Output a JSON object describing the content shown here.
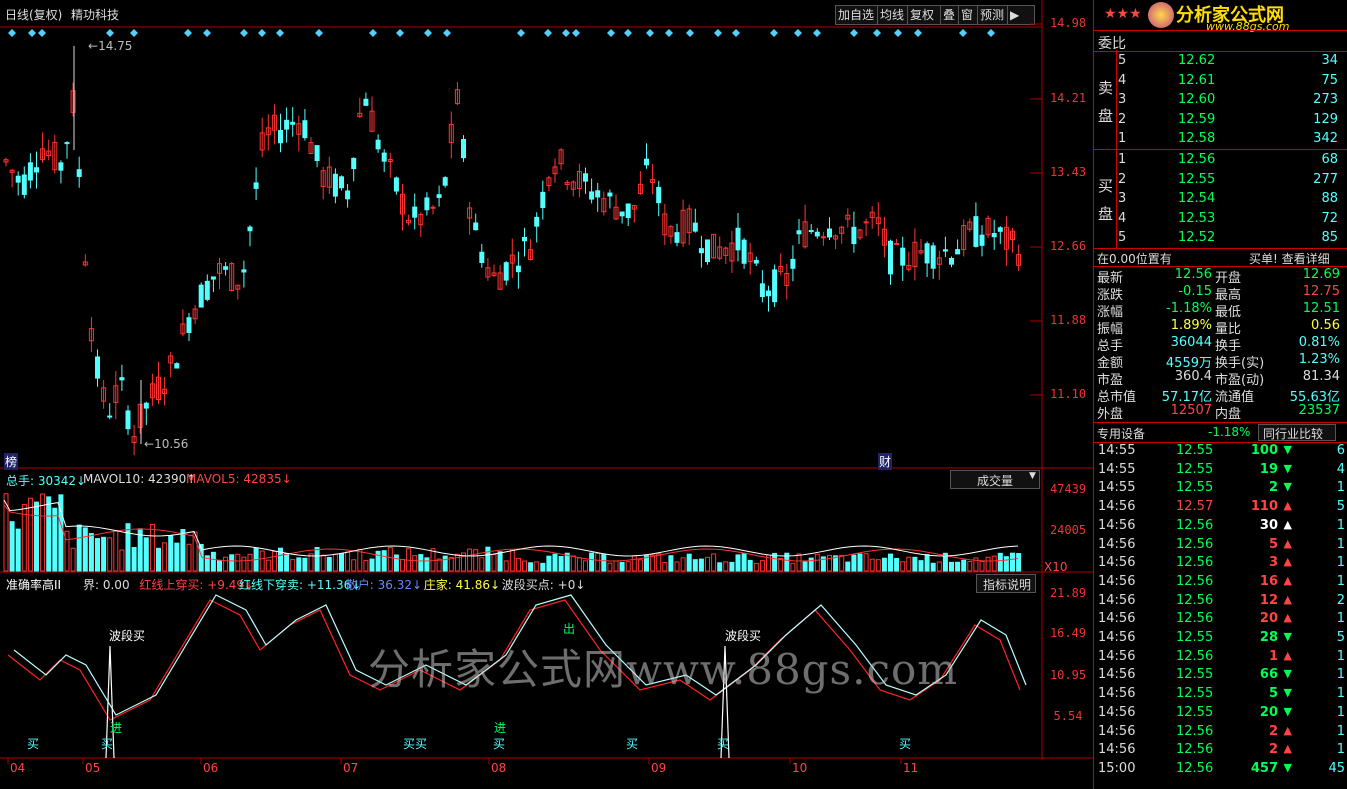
{
  "header": {
    "period_label": "日线(复权)",
    "stock_name": "精功科技",
    "buttons": [
      "加自选",
      "均线",
      "复权",
      "叠",
      "窗",
      "预测",
      "▶"
    ],
    "stars": "★★★",
    "logo_text": "分析家公式网",
    "logo_url": "www.88gs.com"
  },
  "price_chart": {
    "y_ticks": [
      "14.98",
      "14.21",
      "13.43",
      "12.66",
      "11.88",
      "11.10"
    ],
    "high_marker": "14.75",
    "low_marker": "10.56",
    "bang_label": "榜",
    "cai_label": "财"
  },
  "volume_panel": {
    "total_label": "总手: 30342↓",
    "mavol10_label": "MAVOL10: 42390↑",
    "mavol5_label": "MAVOL5: 42835↓",
    "dropdown_label": "成交量",
    "y_ticks": [
      "47439",
      "24005"
    ],
    "unit": "X10"
  },
  "indicator_panel": {
    "name": "准确率高II",
    "params": [
      {
        "text": "界: 0.00",
        "color": "#dddddd"
      },
      {
        "text": "红线上穿买: +9.49↓",
        "color": "#ff4444"
      },
      {
        "text": "红线下穿卖: +11.36↓",
        "color": "#54ffff"
      },
      {
        "text": "散户: 36.32↓",
        "color": "#6688ff"
      },
      {
        "text": "庄家: 41.86↓",
        "color": "#ffff44"
      },
      {
        "text": "波段买点: +0↓",
        "color": "#dddddd"
      }
    ],
    "button": "指标说明",
    "y_ticks": [
      "21.89",
      "16.49",
      "10.95",
      "5.54"
    ],
    "marks": {
      "buy": "买",
      "buy2": "买买",
      "enter": "进",
      "exit": "出",
      "band_buy": "波段买"
    }
  },
  "x_axis": {
    "months": [
      "04",
      "05",
      "06",
      "07",
      "08",
      "09",
      "10",
      "11"
    ]
  },
  "watermark": "分析家公式网www.88gs.com",
  "order_book": {
    "committee_label": "委比",
    "sell_label": "卖盘",
    "buy_label": "买盘",
    "sell": [
      {
        "level": "5",
        "price": "12.62",
        "vol": "34"
      },
      {
        "level": "4",
        "price": "12.61",
        "vol": "75"
      },
      {
        "level": "3",
        "price": "12.60",
        "vol": "273"
      },
      {
        "level": "2",
        "price": "12.59",
        "vol": "129"
      },
      {
        "level": "1",
        "price": "12.58",
        "vol": "342"
      }
    ],
    "buy": [
      {
        "level": "1",
        "price": "12.56",
        "vol": "68"
      },
      {
        "level": "2",
        "price": "12.55",
        "vol": "277"
      },
      {
        "level": "3",
        "price": "12.54",
        "vol": "88"
      },
      {
        "level": "4",
        "price": "12.53",
        "vol": "72"
      },
      {
        "level": "5",
        "price": "12.52",
        "vol": "85"
      }
    ]
  },
  "position_bar": {
    "left": "在0.00位置有",
    "right": "买单! 查看详细"
  },
  "stats": [
    {
      "l1": "最新",
      "v1": "12.56",
      "c1": "#00ff55",
      "l2": "开盘",
      "v2": "12.69",
      "c2": "#00ff55"
    },
    {
      "l1": "涨跌",
      "v1": "-0.15",
      "c1": "#00ff55",
      "l2": "最高",
      "v2": "12.75",
      "c2": "#ff4444"
    },
    {
      "l1": "涨幅",
      "v1": "-1.18%",
      "c1": "#00ff55",
      "l2": "最低",
      "v2": "12.51",
      "c2": "#00ff55"
    },
    {
      "l1": "振幅",
      "v1": "1.89%",
      "c1": "#ffff44",
      "l2": "量比",
      "v2": "0.56",
      "c2": "#ffff44"
    },
    {
      "l1": "总手",
      "v1": "36044",
      "c1": "#54ffff",
      "l2": "换手",
      "v2": "0.81%",
      "c2": "#54ffff"
    },
    {
      "l1": "金额",
      "v1": "4559万",
      "c1": "#54ffff",
      "l2": "换手(实)",
      "v2": "1.23%",
      "c2": "#54ffff"
    },
    {
      "l1": "市盈",
      "v1": "360.4",
      "c1": "#dddddd",
      "l2": "市盈(动)",
      "v2": "81.34",
      "c2": "#dddddd"
    },
    {
      "l1": "总市值",
      "v1": "57.17亿",
      "c1": "#54ffff",
      "l2": "流通值",
      "v2": "55.63亿",
      "c2": "#54ffff"
    },
    {
      "l1": "外盘",
      "v1": "12507",
      "c1": "#ff4444",
      "l2": "内盘",
      "v2": "23537",
      "c2": "#00ff55"
    }
  ],
  "sector": {
    "name": "专用设备",
    "change": "-1.18%",
    "button": "同行业比较"
  },
  "ticks": [
    {
      "time": "14:55",
      "price": "12.55",
      "vol": "100",
      "dir": "down",
      "n": "6"
    },
    {
      "time": "14:55",
      "price": "12.55",
      "vol": "19",
      "dir": "down",
      "n": "4"
    },
    {
      "time": "14:55",
      "price": "12.55",
      "vol": "2",
      "dir": "down",
      "n": "1"
    },
    {
      "time": "14:56",
      "price": "12.57",
      "vol": "110",
      "dir": "up",
      "n": "5"
    },
    {
      "time": "14:56",
      "price": "12.56",
      "vol": "30",
      "dir": "upw",
      "n": "1"
    },
    {
      "time": "14:56",
      "price": "12.56",
      "vol": "5",
      "dir": "up",
      "n": "1"
    },
    {
      "time": "14:56",
      "price": "12.56",
      "vol": "3",
      "dir": "up",
      "n": "1"
    },
    {
      "time": "14:56",
      "price": "12.56",
      "vol": "16",
      "dir": "up",
      "n": "1"
    },
    {
      "time": "14:56",
      "price": "12.56",
      "vol": "12",
      "dir": "up",
      "n": "2"
    },
    {
      "time": "14:56",
      "price": "12.56",
      "vol": "20",
      "dir": "up",
      "n": "1"
    },
    {
      "time": "14:56",
      "price": "12.55",
      "vol": "28",
      "dir": "down",
      "n": "5"
    },
    {
      "time": "14:56",
      "price": "12.56",
      "vol": "1",
      "dir": "up",
      "n": "1"
    },
    {
      "time": "14:56",
      "price": "12.55",
      "vol": "66",
      "dir": "down",
      "n": "1"
    },
    {
      "time": "14:56",
      "price": "12.55",
      "vol": "5",
      "dir": "down",
      "n": "1"
    },
    {
      "time": "14:56",
      "price": "12.55",
      "vol": "20",
      "dir": "down",
      "n": "1"
    },
    {
      "time": "14:56",
      "price": "12.56",
      "vol": "2",
      "dir": "up",
      "n": "1"
    },
    {
      "time": "14:56",
      "price": "12.56",
      "vol": "2",
      "dir": "up",
      "n": "1"
    },
    {
      "time": "15:00",
      "price": "12.56",
      "vol": "457",
      "dir": "down",
      "n": "45"
    }
  ]
}
